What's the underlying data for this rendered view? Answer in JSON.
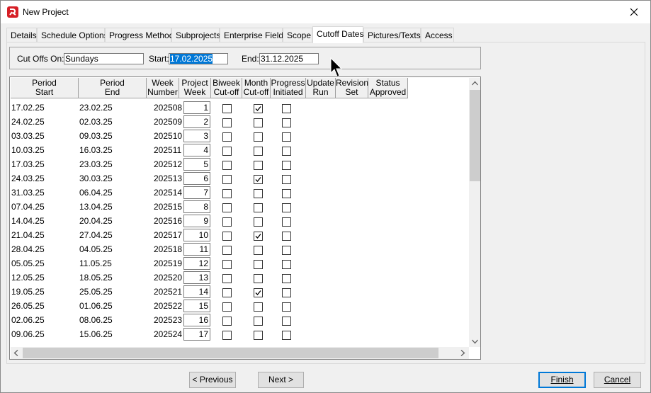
{
  "window": {
    "title": "New Project"
  },
  "tabs": [
    {
      "label": "Details"
    },
    {
      "label": "Schedule Options"
    },
    {
      "label": "Progress Method"
    },
    {
      "label": "Subprojects"
    },
    {
      "label": "Enterprise Fields"
    },
    {
      "label": "Scope"
    },
    {
      "label": "Cutoff Dates",
      "active": true
    },
    {
      "label": "Pictures/Texts"
    },
    {
      "label": "Access"
    }
  ],
  "cutoff": {
    "cutoffs_on_label": "Cut Offs On:",
    "cutoffs_on_value": "Sundays",
    "start_label": "Start:",
    "start_value": "17.02.2025",
    "end_label": "End:",
    "end_value": "31.12.2025"
  },
  "grid": {
    "headers": [
      {
        "line1": "Period",
        "line2": "Start"
      },
      {
        "line1": "Period",
        "line2": "End"
      },
      {
        "line1": "Week",
        "line2": "Number"
      },
      {
        "line1": "Project",
        "line2": "Week"
      },
      {
        "line1": "Biweek",
        "line2": "Cut-off"
      },
      {
        "line1": "Month",
        "line2": "Cut-off"
      },
      {
        "line1": "Progress",
        "line2": "Initiated"
      },
      {
        "line1": "Update",
        "line2": "Run"
      },
      {
        "line1": "Revision",
        "line2": "Set"
      },
      {
        "line1": "Status",
        "line2": "Approved"
      }
    ],
    "rows": [
      {
        "start": "17.02.25",
        "end": "23.02.25",
        "week": "202508",
        "project_week": "1",
        "biweek": false,
        "month": true,
        "progress": false
      },
      {
        "start": "24.02.25",
        "end": "02.03.25",
        "week": "202509",
        "project_week": "2",
        "biweek": false,
        "month": false,
        "progress": false
      },
      {
        "start": "03.03.25",
        "end": "09.03.25",
        "week": "202510",
        "project_week": "3",
        "biweek": false,
        "month": false,
        "progress": false
      },
      {
        "start": "10.03.25",
        "end": "16.03.25",
        "week": "202511",
        "project_week": "4",
        "biweek": false,
        "month": false,
        "progress": false
      },
      {
        "start": "17.03.25",
        "end": "23.03.25",
        "week": "202512",
        "project_week": "5",
        "biweek": false,
        "month": false,
        "progress": false
      },
      {
        "start": "24.03.25",
        "end": "30.03.25",
        "week": "202513",
        "project_week": "6",
        "biweek": false,
        "month": true,
        "progress": false
      },
      {
        "start": "31.03.25",
        "end": "06.04.25",
        "week": "202514",
        "project_week": "7",
        "biweek": false,
        "month": false,
        "progress": false
      },
      {
        "start": "07.04.25",
        "end": "13.04.25",
        "week": "202515",
        "project_week": "8",
        "biweek": false,
        "month": false,
        "progress": false
      },
      {
        "start": "14.04.25",
        "end": "20.04.25",
        "week": "202516",
        "project_week": "9",
        "biweek": false,
        "month": false,
        "progress": false
      },
      {
        "start": "21.04.25",
        "end": "27.04.25",
        "week": "202517",
        "project_week": "10",
        "biweek": false,
        "month": true,
        "progress": false
      },
      {
        "start": "28.04.25",
        "end": "04.05.25",
        "week": "202518",
        "project_week": "11",
        "biweek": false,
        "month": false,
        "progress": false
      },
      {
        "start": "05.05.25",
        "end": "11.05.25",
        "week": "202519",
        "project_week": "12",
        "biweek": false,
        "month": false,
        "progress": false
      },
      {
        "start": "12.05.25",
        "end": "18.05.25",
        "week": "202520",
        "project_week": "13",
        "biweek": false,
        "month": false,
        "progress": false
      },
      {
        "start": "19.05.25",
        "end": "25.05.25",
        "week": "202521",
        "project_week": "14",
        "biweek": false,
        "month": true,
        "progress": false
      },
      {
        "start": "26.05.25",
        "end": "01.06.25",
        "week": "202522",
        "project_week": "15",
        "biweek": false,
        "month": false,
        "progress": false
      },
      {
        "start": "02.06.25",
        "end": "08.06.25",
        "week": "202523",
        "project_week": "16",
        "biweek": false,
        "month": false,
        "progress": false
      },
      {
        "start": "09.06.25",
        "end": "15.06.25",
        "week": "202524",
        "project_week": "17",
        "biweek": false,
        "month": false,
        "progress": false
      }
    ]
  },
  "buttons": {
    "previous": "< Previous",
    "next": "Next >",
    "finish": "Finish",
    "cancel": "Cancel"
  },
  "colors": {
    "accent": "#0078d7",
    "app_icon": "#d61f26"
  }
}
